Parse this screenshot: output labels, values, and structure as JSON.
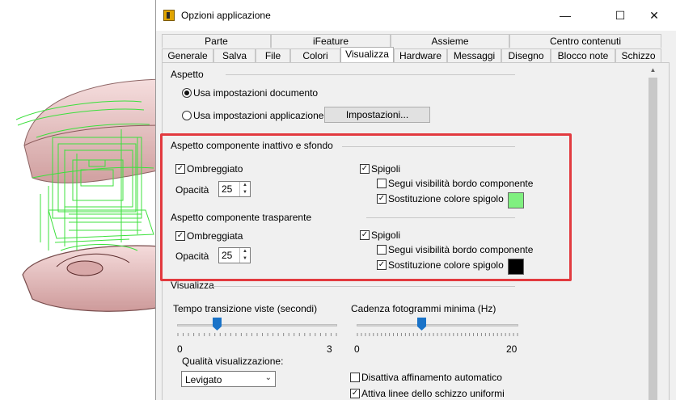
{
  "window": {
    "title": "Opzioni applicazione",
    "minimize": "—",
    "maximize": "☐",
    "close": "✕"
  },
  "tabs_row1": [
    "Parte",
    "iFeature",
    "Assieme",
    "Centro contenuti"
  ],
  "tabs_row2": [
    "Generale",
    "Salva",
    "File",
    "Colori",
    "Visualizza",
    "Hardware",
    "Messaggi",
    "Disegno",
    "Blocco note",
    "Schizzo"
  ],
  "selected_tab": "Visualizza",
  "aspetto": {
    "heading": "Aspetto",
    "opt_document": "Usa impostazioni documento",
    "opt_application": "Usa impostazioni applicazione",
    "selected": "document",
    "settings_button": "Impostazioni..."
  },
  "inactive": {
    "heading": "Aspetto componente inattivo e sfondo",
    "shaded_label": "Ombreggiato",
    "shaded_checked": true,
    "opacity_label": "Opacità",
    "opacity_value": "25",
    "edges_label": "Spigoli",
    "edges_checked": true,
    "follow_label": "Segui visibilità bordo componente",
    "follow_checked": false,
    "replace_label": "Sostituzione colore spigolo",
    "replace_checked": true,
    "edge_color": "#80f080"
  },
  "transparent": {
    "heading": "Aspetto componente trasparente",
    "shaded_label": "Ombreggiata",
    "shaded_checked": true,
    "opacity_label": "Opacità",
    "opacity_value": "25",
    "edges_label": "Spigoli",
    "edges_checked": true,
    "follow_label": "Segui visibilità bordo componente",
    "follow_checked": false,
    "replace_label": "Sostituzione colore spigolo",
    "replace_checked": true,
    "edge_color": "#000000"
  },
  "visualizza": {
    "heading": "Visualizza",
    "transition_label": "Tempo transizione viste (secondi)",
    "transition_min": "0",
    "transition_max": "3",
    "transition_value_fraction": 0.25,
    "framerate_label": "Cadenza fotogrammi minima (Hz)",
    "framerate_min": "0",
    "framerate_max": "20",
    "framerate_value_fraction": 0.4,
    "quality_label": "Qualità visualizzazione:",
    "quality_value": "Levigato",
    "disable_refine_label": "Disattiva affinamento automatico",
    "disable_refine_checked": false,
    "uniform_lines_label": "Attiva linee dello schizzo uniformi",
    "uniform_lines_checked": true
  },
  "colors": {
    "highlight_border": "#e23a3f",
    "slider_thumb": "#1a73c8"
  }
}
